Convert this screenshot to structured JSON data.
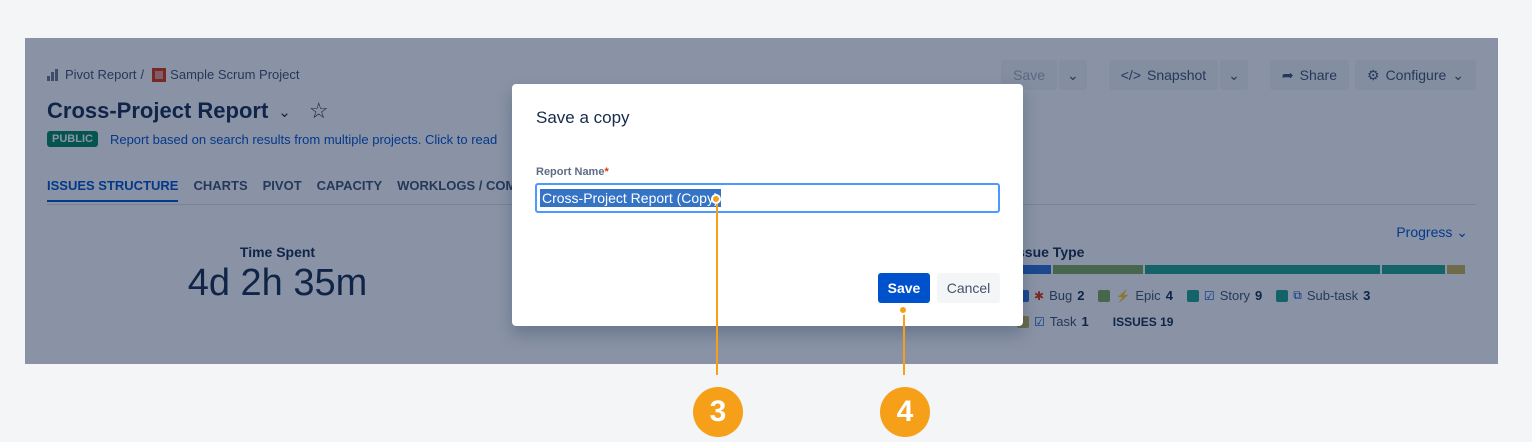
{
  "breadcrumb": {
    "app": "Pivot Report",
    "separator": "/",
    "project": "Sample Scrum Project"
  },
  "header": {
    "title": "Cross-Project Report",
    "badge": "PUBLIC",
    "description": "Report based on search results from multiple projects. Click to read"
  },
  "toolbar": {
    "save": "Save",
    "snapshot": "Snapshot",
    "share": "Share",
    "configure": "Configure"
  },
  "tabs": [
    "ISSUES STRUCTURE",
    "CHARTS",
    "PIVOT",
    "CAPACITY",
    "WORKLOGS / COMME"
  ],
  "stat": {
    "label": "Time Spent",
    "value": "4d 2h 35m"
  },
  "issue_type": {
    "title": "ssue Type",
    "progress_label": "Progress",
    "bar": [
      {
        "color": "#2f6fd6",
        "fraction": 0.075
      },
      {
        "color": "#7fab58",
        "fraction": 0.2
      },
      {
        "color": "#1ea38a",
        "fraction": 0.52
      },
      {
        "color": "#1ea38a",
        "fraction": 0.14
      },
      {
        "color": "#c9b24f",
        "fraction": 0.04
      }
    ],
    "legend": [
      {
        "label": "Bug",
        "count": "2",
        "color": "#2f6fd6"
      },
      {
        "label": "Epic",
        "count": "4",
        "color": "#7fab58"
      },
      {
        "label": "Story",
        "count": "9",
        "color": "#1ea38a"
      },
      {
        "label": "Sub-task",
        "count": "3",
        "color": "#1ea38a"
      },
      {
        "label": "Task",
        "count": "1",
        "color": "#c9b24f"
      }
    ],
    "total_label": "ISSUES",
    "total": "19"
  },
  "modal": {
    "title": "Save a copy",
    "field_label": "Report Name",
    "required_mark": "*",
    "field_value": "Cross-Project Report (Copy)",
    "save": "Save",
    "cancel": "Cancel"
  },
  "callouts": {
    "first": "3",
    "second": "4"
  },
  "colors": {
    "accent": "#0052cc",
    "callout": "#f6a01a",
    "overlay": "rgba(9,30,66,0.48)"
  }
}
